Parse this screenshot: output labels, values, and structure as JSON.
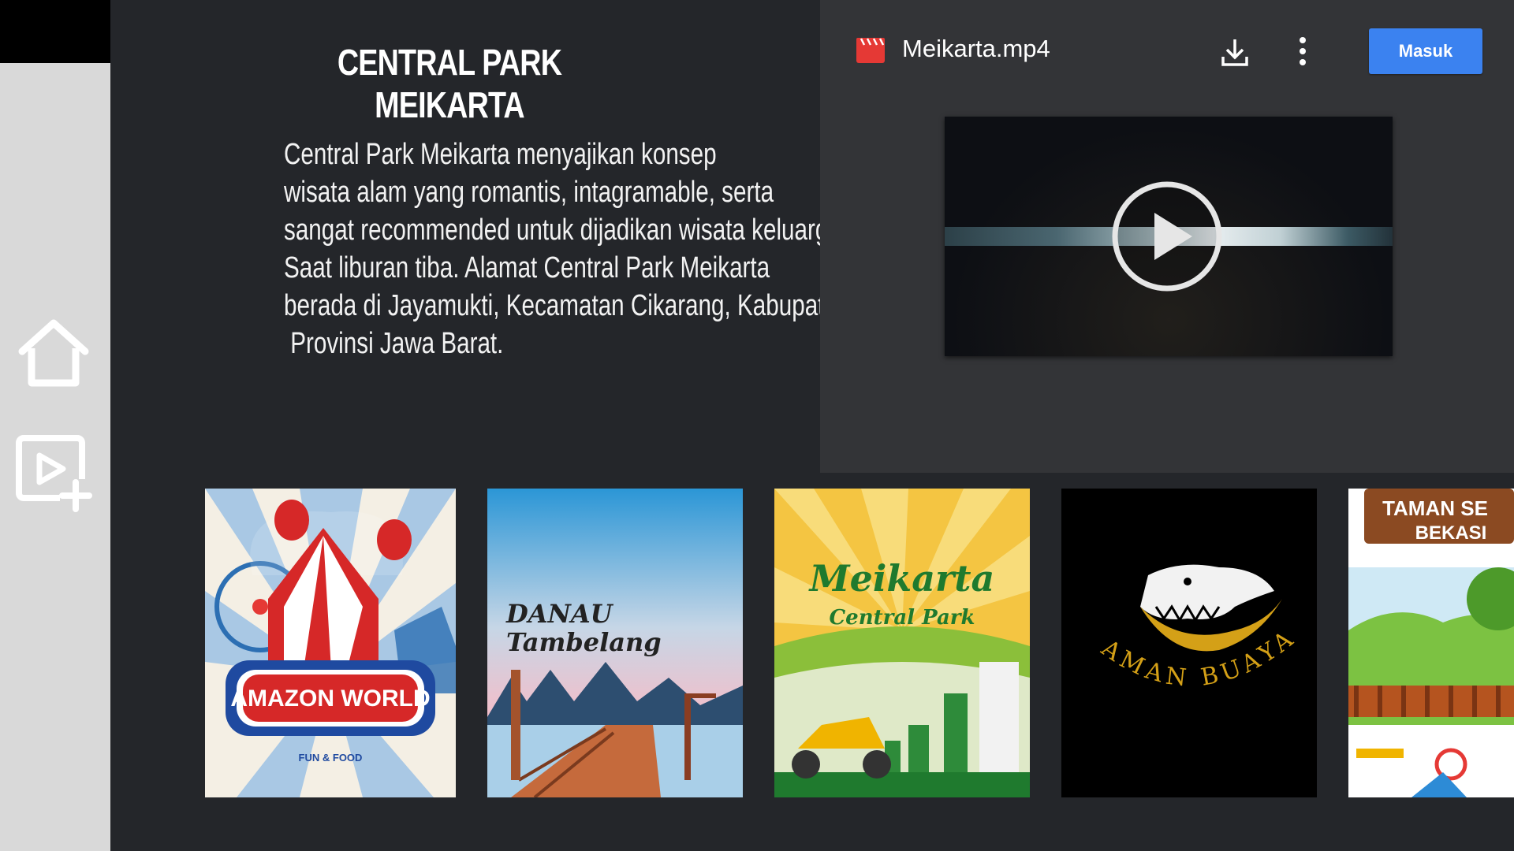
{
  "page": {
    "title": "CENTRAL PARK MEIKARTA",
    "description_lines": [
      "Central Park Meikarta menyajikan konsep",
      "wisata alam yang romantis, intagramable, serta",
      "sangat recommended untuk dijadikan wisata keluarga",
      "Saat liburan tiba. Alamat Central Park Meikarta",
      "berada di Jayamukti, Kecamatan Cikarang, Kabupaten Bekasi,",
      " Provinsi Jawa Barat."
    ]
  },
  "sidebar": {
    "items": [
      {
        "icon": "home-icon"
      },
      {
        "icon": "video-add-icon"
      }
    ]
  },
  "viewer": {
    "file_name": "Meikarta.mp4",
    "file_icon": "video-file-icon",
    "download_icon": "download-icon",
    "more_icon": "more-vert-icon",
    "signin_label": "Masuk",
    "accent": "#3b82f0",
    "play_icon": "play-icon"
  },
  "gallery": [
    {
      "name": "amazon-world-poster",
      "line1": "AMAZON WORLD",
      "line2": "FUN & FOOD"
    },
    {
      "name": "danau-tambelang-poster",
      "line1": "DANAU",
      "line2": "Tambelang"
    },
    {
      "name": "meikarta-central-park-poster",
      "line1": "Meikarta",
      "line2": "Central Park"
    },
    {
      "name": "taman-buaya-poster",
      "line1": "TAMAN BUAYA"
    },
    {
      "name": "taman-bekasi-poster",
      "line1": "TAMAN SE",
      "line2": "BEKASI"
    }
  ]
}
